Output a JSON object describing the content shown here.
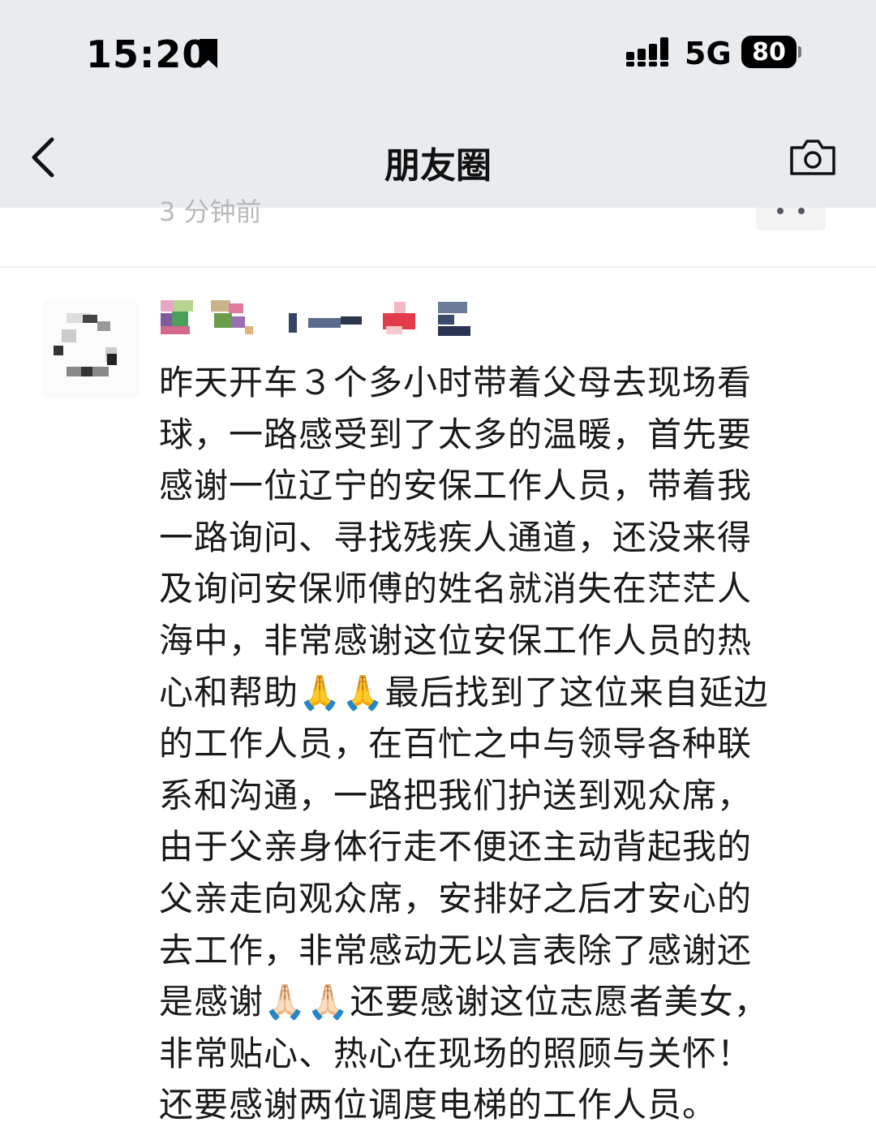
{
  "status_bar": {
    "time": "15:20",
    "network": "5G",
    "battery": "80"
  },
  "nav": {
    "title": "朋友圈"
  },
  "previous_post": {
    "time": "3 分钟前"
  },
  "post": {
    "lines": [
      "昨天开车３个多小时带着父母去现场看",
      "球，一路感受到了太多的温暖，首先要",
      "感谢一位辽宁的安保工作人员，带着我",
      "一路询问、寻找残疾人通道，还没来得",
      "及询问安保师傅的姓名就消失在茫茫人",
      "海中，非常感谢这位安保工作人员的热",
      "心和帮助🙏🙏最后找到了这位来自延边",
      "的工作人员，在百忙之中与领导各种联",
      "系和沟通，一路把我们护送到观众席，",
      "由于父亲身体行走不便还主动背起我的",
      "父亲走向观众席，安排好之后才安心的",
      "去工作，非常感动无以言表除了感谢还",
      "是感谢🙏🏻🙏🏻还要感谢这位志愿者美女，",
      "非常贴心、热心在现场的照顾与关怀！",
      "还要感谢两位调度电梯的工作人员。"
    ]
  }
}
